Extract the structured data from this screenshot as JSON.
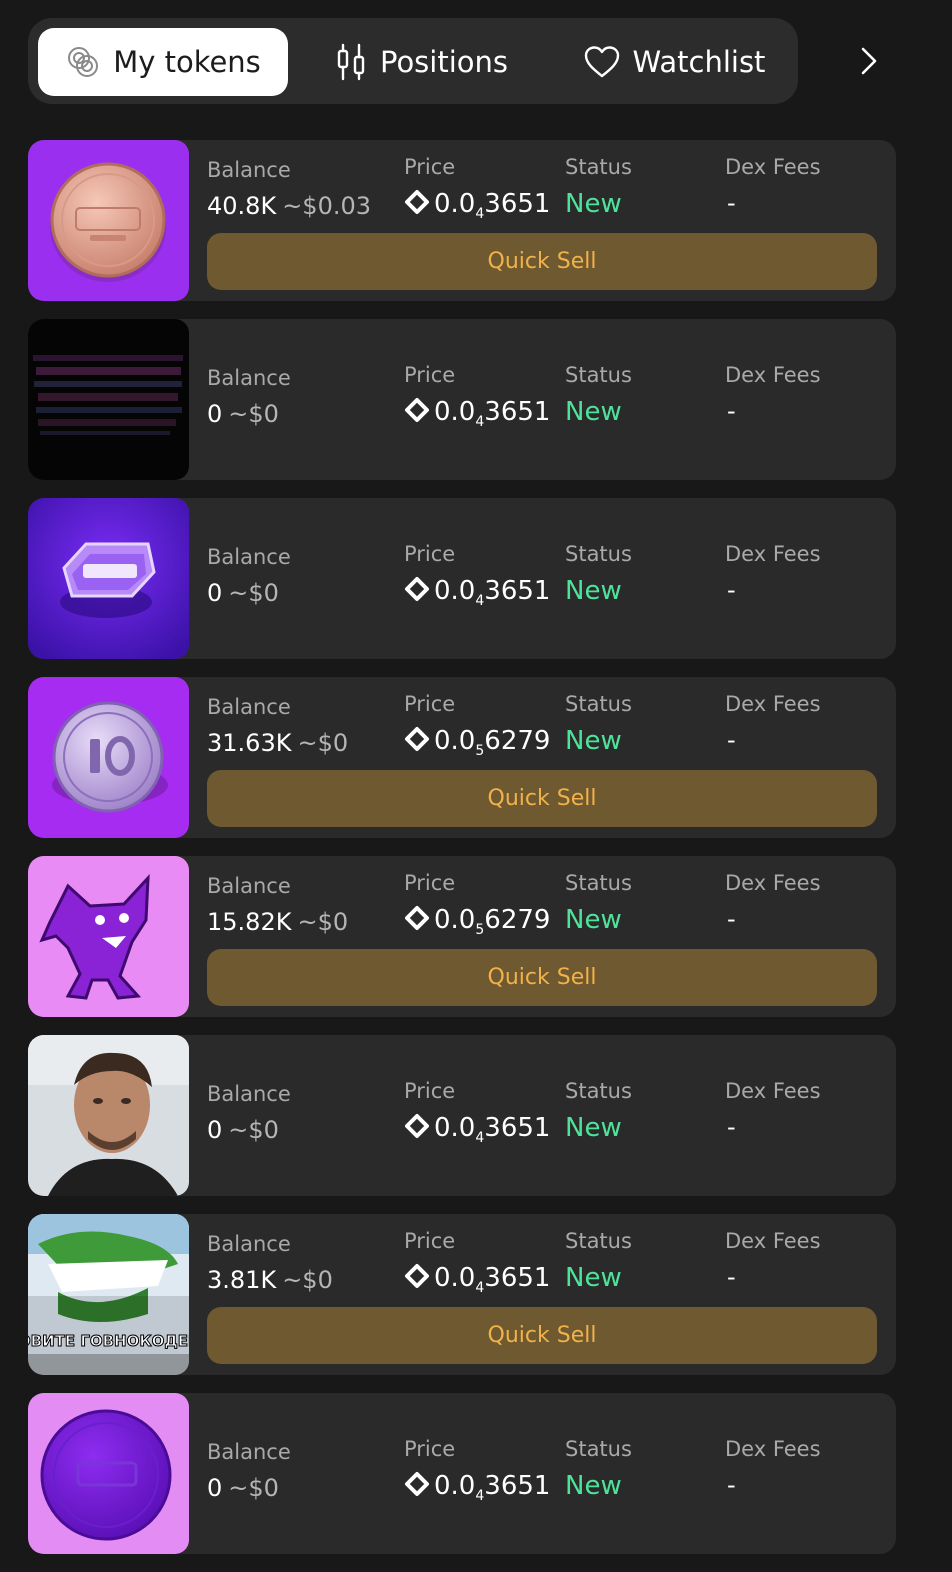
{
  "tabs": [
    {
      "label": "My tokens",
      "icon": "coins-icon",
      "active": true
    },
    {
      "label": "Positions",
      "icon": "candlestick-icon",
      "active": false
    },
    {
      "label": "Watchlist",
      "icon": "heart-icon",
      "active": false
    }
  ],
  "labels": {
    "balance": "Balance",
    "price": "Price",
    "status": "Status",
    "dex_fees": "Dex Fees"
  },
  "tokens": [
    {
      "image": "test-token-coin",
      "balance": "40.8K",
      "usd": "~$0.03",
      "price_prefix": "0.0",
      "price_zeros": "4",
      "price_digits": "3651",
      "status": "New",
      "dex_fees": "-",
      "quick_sell": "Quick Sell"
    },
    {
      "image": "dark-glitch-token",
      "balance": "0",
      "usd": "~$0",
      "price_prefix": "0.0",
      "price_zeros": "4",
      "price_digits": "3651",
      "status": "New",
      "dex_fees": "-"
    },
    {
      "image": "tdd-token",
      "balance": "0",
      "usd": "~$0",
      "price_prefix": "0.0",
      "price_zeros": "4",
      "price_digits": "3651",
      "status": "New",
      "dex_fees": "-"
    },
    {
      "image": "ten-coin-token",
      "balance": "31.63K",
      "usd": "~$0",
      "price_prefix": "0.0",
      "price_zeros": "5",
      "price_digits": "6279",
      "status": "New",
      "dex_fees": "-",
      "quick_sell": "Quick Sell"
    },
    {
      "image": "purple-wolf-token",
      "balance": "15.82K",
      "usd": "~$0",
      "price_prefix": "0.0",
      "price_zeros": "5",
      "price_digits": "6279",
      "status": "New",
      "dex_fees": "-",
      "quick_sell": "Quick Sell"
    },
    {
      "image": "man-portrait-token",
      "balance": "0",
      "usd": "~$0",
      "price_prefix": "0.0",
      "price_zeros": "4",
      "price_digits": "3651",
      "status": "New",
      "dex_fees": "-"
    },
    {
      "image": "crocodile-meme-token",
      "image_caption": "ЛОВИТЕ ГОВНОКОДЕРА",
      "balance": "3.81K",
      "usd": "~$0",
      "price_prefix": "0.0",
      "price_zeros": "4",
      "price_digits": "3651",
      "status": "New",
      "dex_fees": "-",
      "quick_sell": "Quick Sell"
    },
    {
      "image": "purple-coin-token",
      "balance": "0",
      "usd": "~$0",
      "price_prefix": "0.0",
      "price_zeros": "4",
      "price_digits": "3651",
      "status": "New",
      "dex_fees": "-"
    }
  ],
  "colors": {
    "status_new": "#4ee39a",
    "quick_sell_bg": "#6f5930",
    "quick_sell_text": "#f1b24a",
    "card_bg": "#2a2a2a",
    "page_bg": "#181818"
  }
}
